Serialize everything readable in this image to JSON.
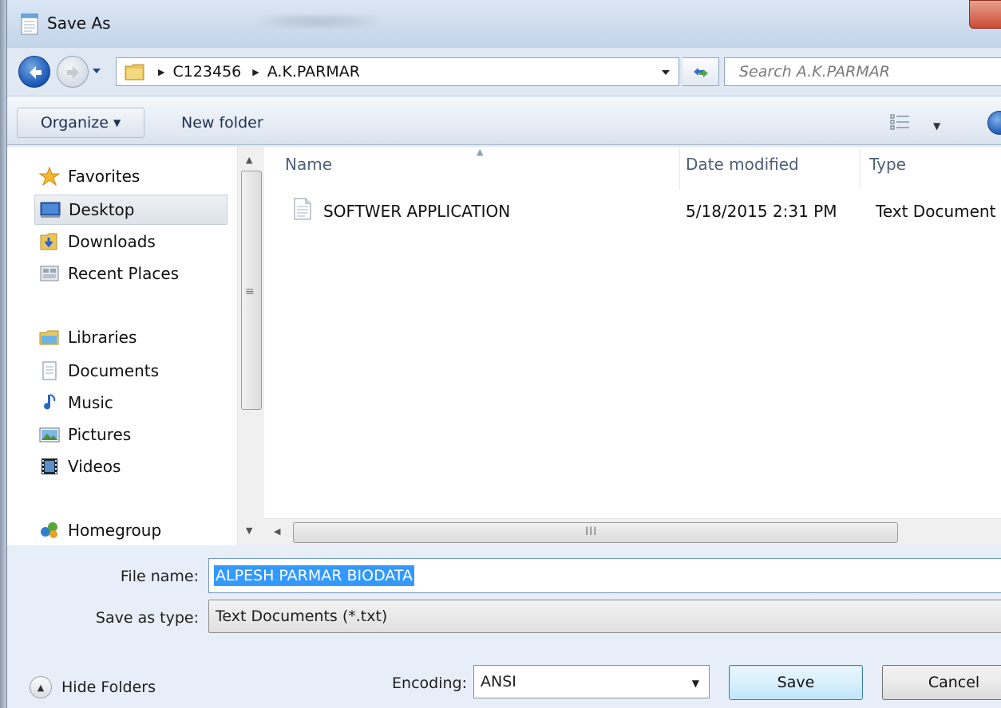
{
  "window": {
    "title": "Save As"
  },
  "address": {
    "breadcrumbs": [
      "C123456",
      "A.K.PARMAR"
    ],
    "search_placeholder": "Search A.K.PARMAR"
  },
  "toolbar": {
    "organize_label": "Organize",
    "new_folder_label": "New folder"
  },
  "navigation": {
    "favorites": {
      "label": "Favorites",
      "items": [
        "Desktop",
        "Downloads",
        "Recent Places"
      ],
      "selected": "Desktop"
    },
    "libraries": {
      "label": "Libraries",
      "items": [
        "Documents",
        "Music",
        "Pictures",
        "Videos"
      ]
    },
    "homegroup": {
      "label": "Homegroup"
    }
  },
  "file_list": {
    "columns": [
      "Name",
      "Date modified",
      "Type"
    ],
    "rows": [
      {
        "name": "SOFTWER APPLICATION",
        "date_modified": "5/18/2015 2:31 PM",
        "type": "Text Document"
      }
    ]
  },
  "form": {
    "file_name_label": "File name:",
    "file_name_value": "ALPESH PARMAR BIODATA",
    "save_type_label": "Save as type:",
    "save_type_value": "Text Documents (*.txt)",
    "hide_folders_label": "Hide Folders",
    "encoding_label": "Encoding:",
    "encoding_value": "ANSI",
    "save_label": "Save",
    "cancel_label": "Cancel"
  },
  "colors": {
    "selection": "#3399ff",
    "window_frame": "#dfe8f3",
    "default_button_border": "#3c7fb1"
  }
}
